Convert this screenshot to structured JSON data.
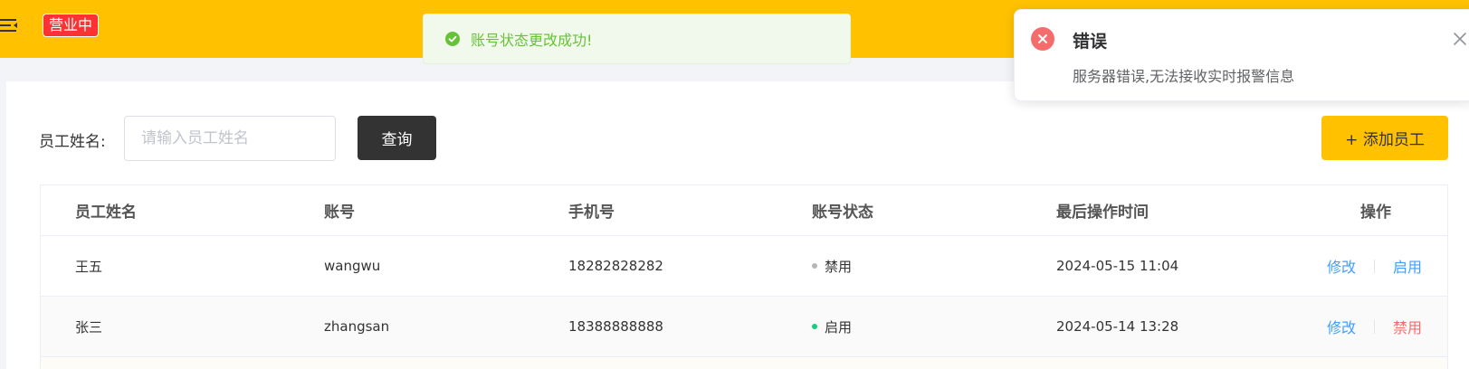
{
  "header": {
    "status_tag": "营业中",
    "menu_icon": "menu-fold-icon",
    "bg_color": "#ffc100"
  },
  "success_message": {
    "text": "账号状态更改成功!",
    "icon": "check-circle-icon",
    "color": "#67c23a"
  },
  "search": {
    "label": "员工姓名:",
    "placeholder": "请输入员工姓名",
    "value": "",
    "query_button": "查询"
  },
  "add_button": "+ 添加员工",
  "table": {
    "headers": [
      "员工姓名",
      "账号",
      "手机号",
      "账号状态",
      "最后操作时间",
      "操作"
    ],
    "rows": [
      {
        "name": "王五",
        "account": "wangwu",
        "phone": "18282828282",
        "status": "禁用",
        "status_color": "#b7b7b7",
        "time": "2024-05-15 11:04",
        "edit": "修改",
        "toggle": "启用"
      },
      {
        "name": "张三",
        "account": "zhangsan",
        "phone": "18388888888",
        "status": "启用",
        "status_color": "#12d07d",
        "time": "2024-05-14 13:28",
        "edit": "修改",
        "toggle": "禁用"
      }
    ]
  },
  "notification": {
    "title": "错误",
    "message": "服务器错误,无法接收实时报警信息",
    "icon": "error-circle-icon",
    "close_icon": "close-icon"
  }
}
